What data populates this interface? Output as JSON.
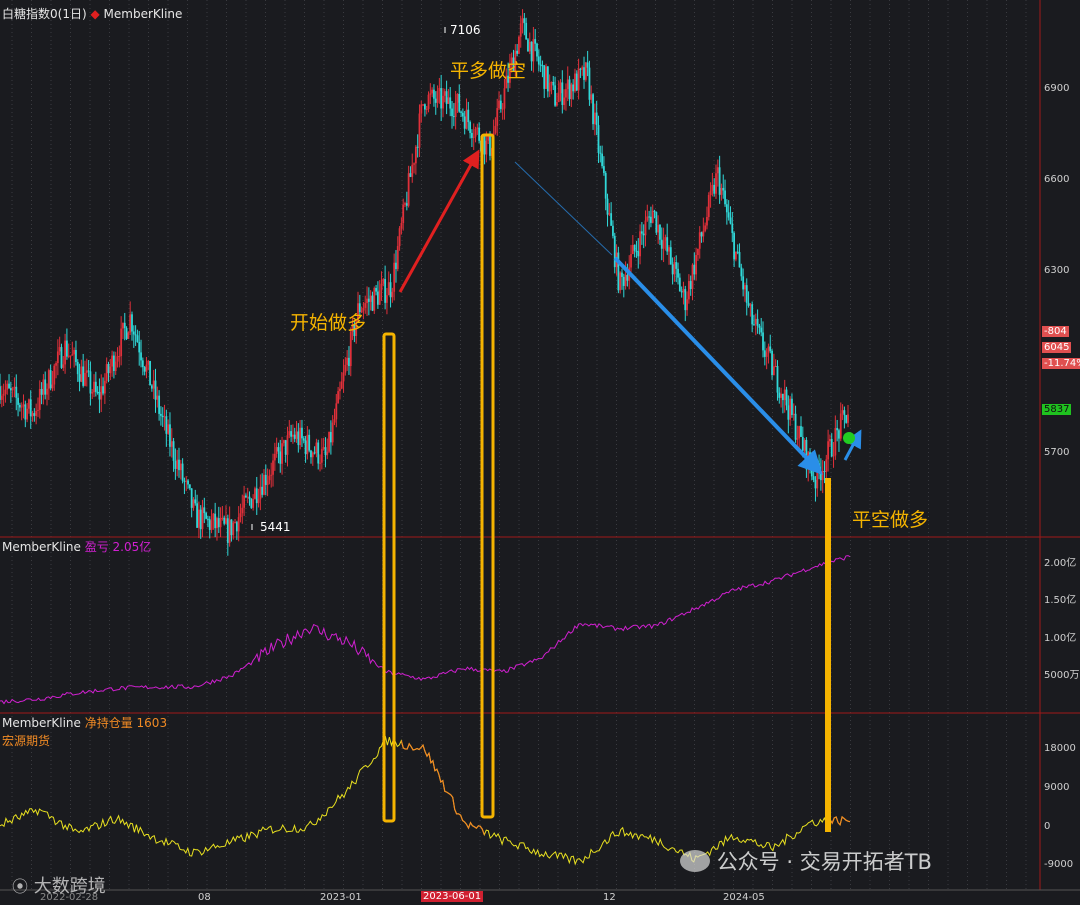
{
  "header": {
    "instrument": "白糖指数0(1日)",
    "indicator": "MemberKline",
    "bullet_color": "#e02020"
  },
  "panel2": {
    "name": "MemberKline",
    "metric": "盈亏 2.05亿",
    "color": "#d020d0"
  },
  "panel3": {
    "name": "MemberKline",
    "metric": "净持仓量 1603",
    "broker": "宏源期货",
    "color": "#f08a24"
  },
  "annotations": {
    "start_long": "开始做多",
    "close_long_short": "平多做空",
    "close_short_long": "平空做多"
  },
  "price_marks": {
    "high": "7106",
    "low": "5441"
  },
  "side_tags": {
    "change": "-804",
    "ref_price": "6045",
    "change_pct": "-11.74%",
    "last_price": "5837"
  },
  "watermarks": {
    "left": "大数跨境",
    "right": "公众号 · 交易开拓者TB"
  },
  "axis": {
    "x_ticks": [
      "2022-02-28",
      "08",
      "2023-01",
      "2023-06-01",
      "12",
      "2024-05"
    ],
    "price_ticks": [
      "6900",
      "6600",
      "6300",
      "5700"
    ],
    "pnl_ticks": [
      "2.00亿",
      "1.50亿",
      "1.00亿",
      "5000万"
    ],
    "pos_ticks": [
      "18000",
      "9000",
      "0",
      "-9000"
    ]
  },
  "colors": {
    "background": "#1a1b1f",
    "up_candle": "#e0303a",
    "down_candle": "#30d8d8",
    "pnl_line": "#d020d0",
    "position_line_low": "#e8e020",
    "position_line_high": "#f08a24",
    "highlight_box": "#f5b400",
    "long_arrow": "#e02020",
    "short_arrow": "#2a8ee8",
    "separator": "#a01818"
  },
  "chart_data": [
    {
      "type": "candlestick",
      "title": "白糖指数0(1日)",
      "ylim": [
        5441,
        7106
      ],
      "x": [
        "2022-02-28",
        "2022-08",
        "2023-01",
        "2023-06-01",
        "2023-12",
        "2024-05"
      ],
      "approx_close_path": [
        5920,
        5830,
        6050,
        5880,
        6150,
        5800,
        5490,
        5441,
        5600,
        5760,
        5680,
        6180,
        6250,
        6870,
        6850,
        6700,
        7106,
        6870,
        6950,
        6250,
        6500,
        6200,
        6620,
        6150,
        5900,
        5610,
        5837
      ],
      "high": 7106,
      "low": 5441,
      "last": 5837,
      "annotations": [
        "开始做多",
        "平多做空",
        "平空做多"
      ]
    },
    {
      "type": "line",
      "series_label": "盈亏 2.05亿",
      "yticks": [
        "2.00亿",
        "1.50亿",
        "1.00亿",
        "5000万"
      ],
      "values_yi": [
        0.1,
        0.14,
        0.22,
        0.28,
        0.3,
        0.3,
        0.45,
        0.8,
        1.1,
        0.9,
        0.5,
        0.4,
        0.55,
        0.5,
        0.68,
        1.15,
        1.08,
        1.12,
        1.35,
        1.6,
        1.72,
        1.9,
        2.05
      ]
    },
    {
      "type": "line",
      "series_label": "净持仓量 1603",
      "yticks": [
        "18000",
        "9000",
        "0",
        "-9000"
      ],
      "values": [
        500,
        4000,
        -1500,
        2000,
        -2500,
        -6000,
        -3500,
        -500,
        0,
        8500,
        20000,
        18000,
        1000,
        -3000,
        -6000,
        -8000,
        -1000,
        -3000,
        -7500,
        -2000,
        -5000,
        1200,
        1603
      ]
    }
  ]
}
